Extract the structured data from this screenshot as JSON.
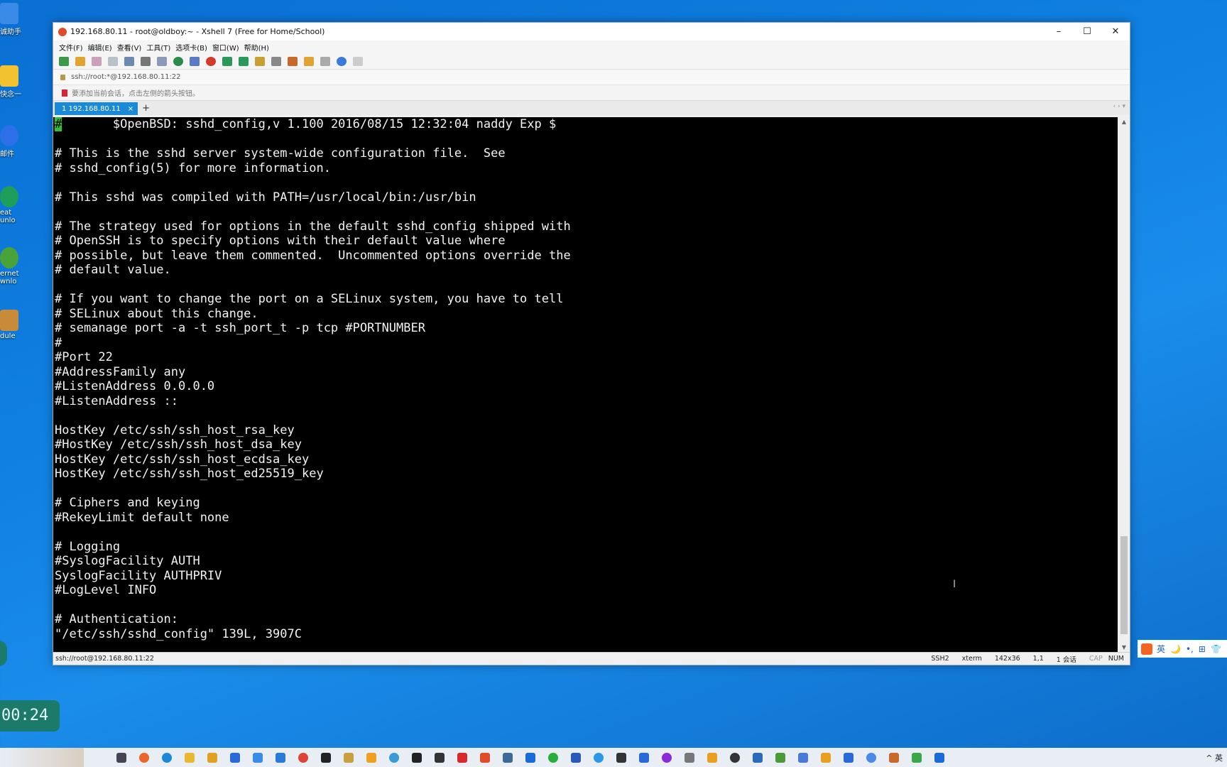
{
  "desktop": {
    "icons": [
      {
        "label": "诚助手",
        "color": "#3a8be8"
      },
      {
        "label": "快念一",
        "color": "#f2c230"
      },
      {
        "label": "邮件",
        "color": "#2d6fe8"
      },
      {
        "label": "eat\nunlo",
        "color": "#1e9e5a"
      },
      {
        "label": "ernet\nwnlo",
        "color": "#4aa33a"
      },
      {
        "label": "dule",
        "color": "#c98a3a"
      }
    ],
    "timer": "00:24"
  },
  "window": {
    "title": "192.168.80.11 - root@oldboy:~ - Xshell 7 (Free for Home/School)",
    "menu": [
      "文件(F)",
      "编辑(E)",
      "查看(V)",
      "工具(T)",
      "选项卡(B)",
      "窗口(W)",
      "帮助(H)"
    ],
    "address": "ssh://root:*@192.168.80.11:22",
    "hint": "要添加当前会话，点击左侧的箭头按钮。",
    "tab_label": "1 192.168.80.11",
    "tab_close": "×",
    "tab_add": "+"
  },
  "terminal": {
    "cursor_char": "#",
    "first_line_rest": "       $OpenBSD: sshd_config,v 1.100 2016/08/15 12:32:04 naddy Exp $",
    "lines": [
      "",
      "# This is the sshd server system-wide configuration file.  See",
      "# sshd_config(5) for more information.",
      "",
      "# This sshd was compiled with PATH=/usr/local/bin:/usr/bin",
      "",
      "# The strategy used for options in the default sshd_config shipped with",
      "# OpenSSH is to specify options with their default value where",
      "# possible, but leave them commented.  Uncommented options override the",
      "# default value.",
      "",
      "# If you want to change the port on a SELinux system, you have to tell",
      "# SELinux about this change.",
      "# semanage port -a -t ssh_port_t -p tcp #PORTNUMBER",
      "#",
      "#Port 22",
      "#AddressFamily any",
      "#ListenAddress 0.0.0.0",
      "#ListenAddress ::",
      "",
      "HostKey /etc/ssh/ssh_host_rsa_key",
      "#HostKey /etc/ssh/ssh_host_dsa_key",
      "HostKey /etc/ssh/ssh_host_ecdsa_key",
      "HostKey /etc/ssh/ssh_host_ed25519_key",
      "",
      "# Ciphers and keying",
      "#RekeyLimit default none",
      "",
      "# Logging",
      "#SyslogFacility AUTH",
      "SyslogFacility AUTHPRIV",
      "#LogLevel INFO",
      "",
      "# Authentication:",
      "\"/etc/ssh/sshd_config\" 139L, 3907C"
    ]
  },
  "statusbar": {
    "left": "ssh://root@192.168.80.11:22",
    "protocol": "SSH2",
    "term": "xterm",
    "size": "142x36",
    "pos": "1,1",
    "sessions": "1 会话",
    "cap": "CAP",
    "num": "NUM"
  },
  "ime": {
    "lang": "英",
    "items": [
      "英",
      "🌙",
      "•,",
      "⊞",
      "👕"
    ]
  },
  "tray": {
    "lang": "英"
  }
}
